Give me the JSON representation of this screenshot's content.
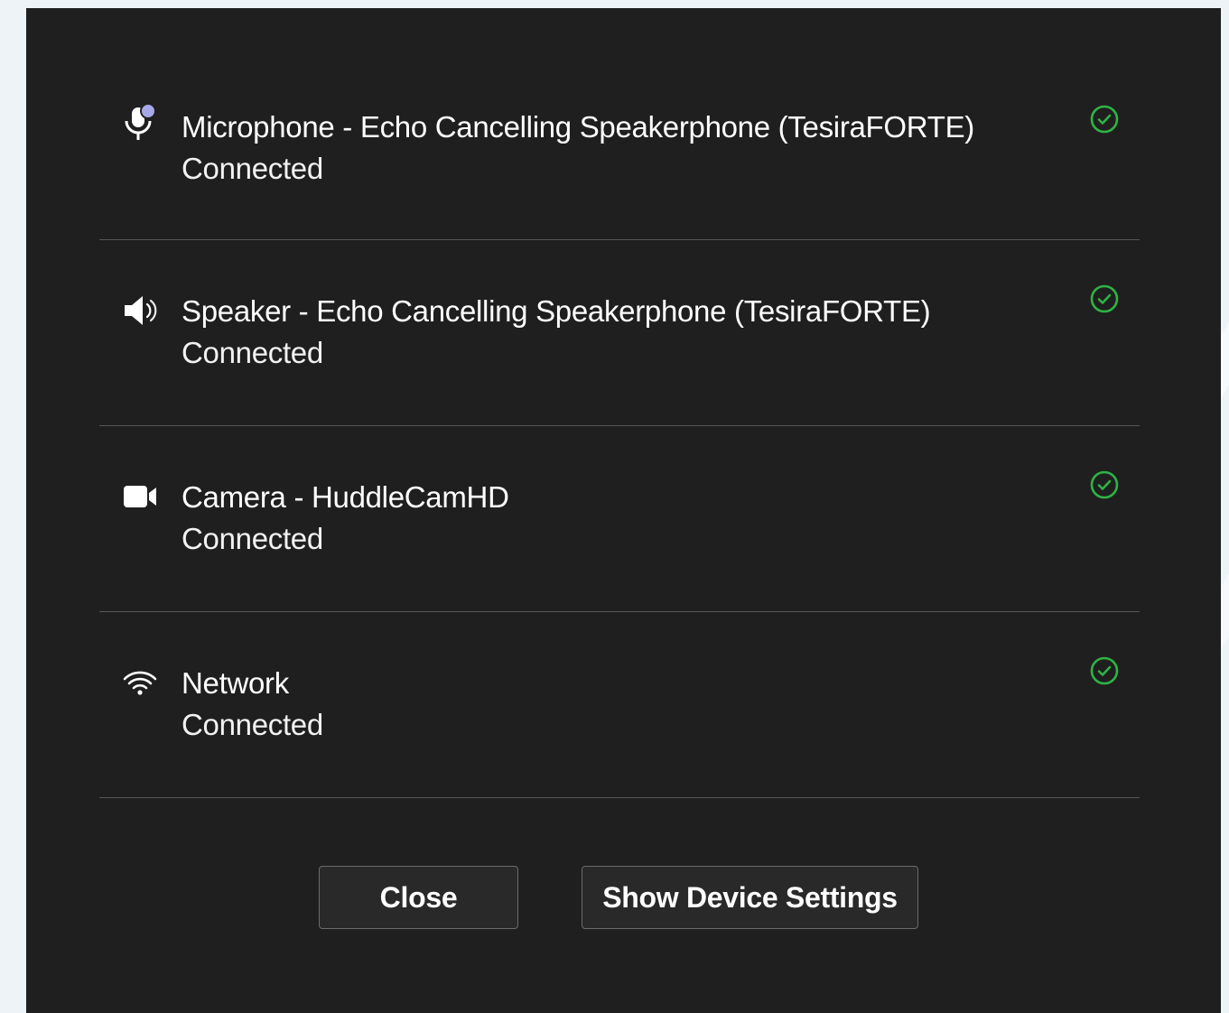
{
  "devices": [
    {
      "icon": "microphone-icon",
      "title": "Microphone - Echo Cancelling Speakerphone (TesiraFORTE)",
      "status": "Connected"
    },
    {
      "icon": "speaker-icon",
      "title": "Speaker - Echo Cancelling Speakerphone (TesiraFORTE)",
      "status": "Connected"
    },
    {
      "icon": "camera-icon",
      "title": "Camera - HuddleCamHD",
      "status": "Connected"
    },
    {
      "icon": "network-icon",
      "title": "Network",
      "status": "Connected"
    }
  ],
  "buttons": {
    "close_label": "Close",
    "settings_label": "Show Device Settings"
  },
  "colors": {
    "dialog_background": "#1f1f1f",
    "status_ok": "#2fb344",
    "mic_accent": "#a7a8e8",
    "divider": "#575757"
  }
}
